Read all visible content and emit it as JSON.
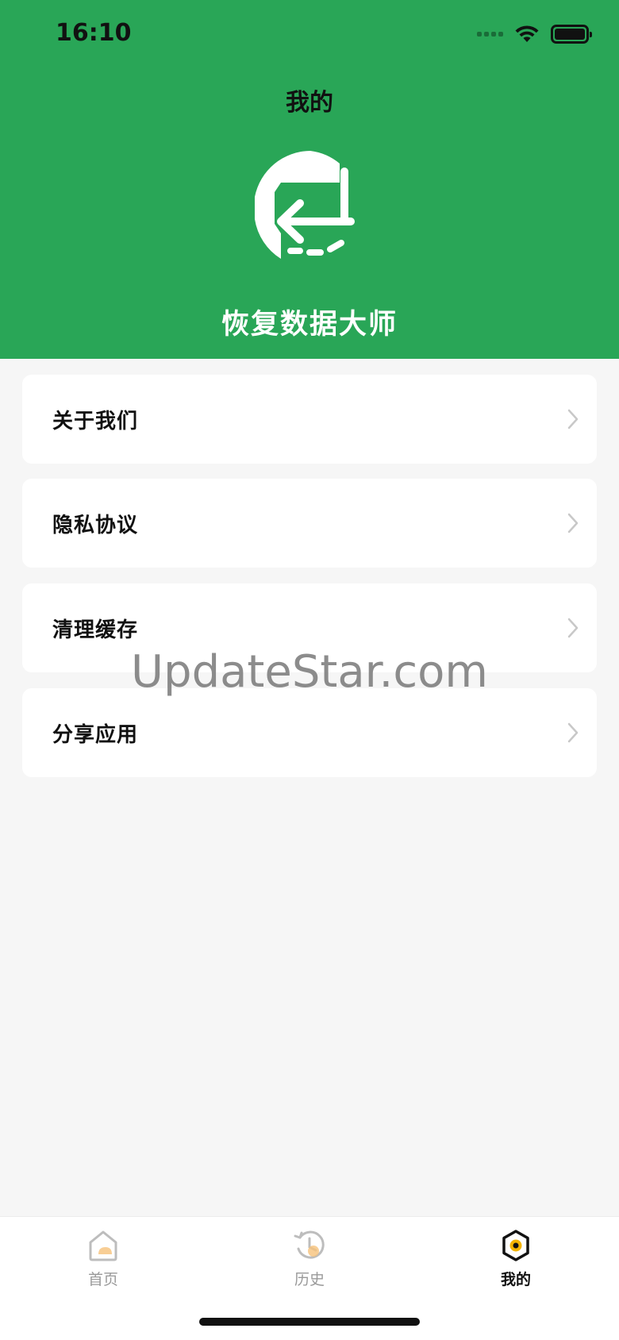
{
  "status_bar": {
    "time": "16:10"
  },
  "header": {
    "title": "我的",
    "app_name": "恢复数据大师"
  },
  "menu": [
    {
      "label": "关于我们"
    },
    {
      "label": "隐私协议"
    },
    {
      "label": "清理缓存"
    },
    {
      "label": "分享应用"
    }
  ],
  "watermark": "UpdateStar.com",
  "tabbar": {
    "tabs": [
      {
        "label": "首页",
        "icon": "home-icon",
        "active": false
      },
      {
        "label": "历史",
        "icon": "history-icon",
        "active": false
      },
      {
        "label": "我的",
        "icon": "profile-icon",
        "active": true
      }
    ]
  },
  "colors": {
    "brand_green": "#29a657",
    "active_tab": "#111111",
    "inactive_tab": "#9a9a9a",
    "accent_yellow": "#f4b400"
  }
}
